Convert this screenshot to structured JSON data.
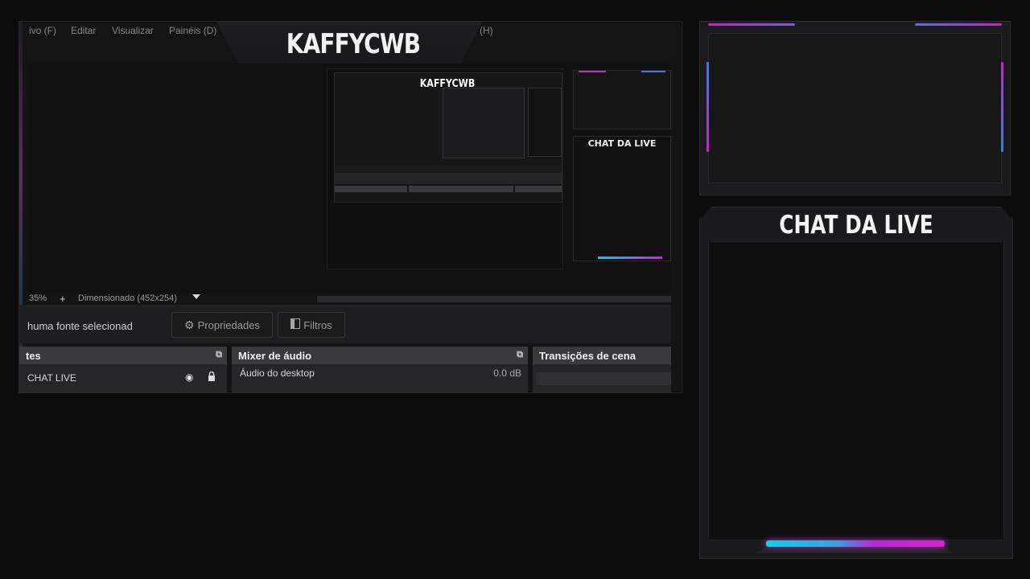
{
  "capture": {
    "menu": [
      "ivo (F)",
      "Editar",
      "Visualizar",
      "Painéis (D)",
      "(H)"
    ],
    "title": "KAFFYCWB",
    "preview": {
      "mini_title": "KAFFYCWB",
      "mini_chat_title": "CHAT DA LIVE"
    },
    "status": {
      "zoom": "35%",
      "add_icon": "+",
      "scale_mode": "Dimensionado (452x254)",
      "dropdown_icon": "chevron-down-icon"
    },
    "toolbar": {
      "no_source": "huma fonte selecionad",
      "properties_label": "Propriedades",
      "filters_label": "Filtros"
    },
    "docks": {
      "sources": {
        "title": "tes",
        "item": "CHAT LIVE"
      },
      "mixer": {
        "title": "Mixer de áudio",
        "item": "Áudio do desktop",
        "level": "0.0 dB"
      },
      "transitions": {
        "title": "Transições de cena"
      }
    }
  },
  "chat_panel": {
    "title": "CHAT DA LIVE"
  },
  "colors": {
    "accent_pink": "#d026c8",
    "accent_cyan": "#14d0e0",
    "accent_blue": "#3a7ee0",
    "background": "#0c0c0d"
  }
}
